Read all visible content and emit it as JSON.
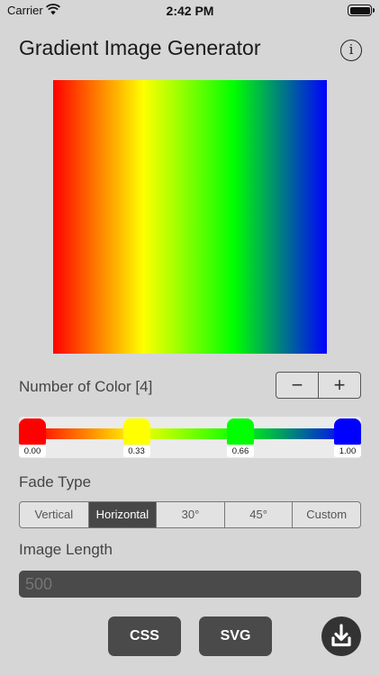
{
  "status": {
    "carrier": "Carrier",
    "time": "2:42 PM"
  },
  "header": {
    "title": "Gradient Image Generator",
    "info_glyph": "i"
  },
  "colors": {
    "count_label": "Number of Color [4]",
    "minus": "−",
    "plus": "+"
  },
  "stops": [
    {
      "color": "#ff0000",
      "value": "0.00"
    },
    {
      "color": "#ffff00",
      "value": "0.33"
    },
    {
      "color": "#00ff00",
      "value": "0.66"
    },
    {
      "color": "#0000ff",
      "value": "1.00"
    }
  ],
  "fade": {
    "label": "Fade Type",
    "options": [
      "Vertical",
      "Horizontal",
      "30°",
      "45°",
      "Custom"
    ],
    "selected": "Horizontal"
  },
  "length": {
    "label": "Image Length",
    "placeholder": "500"
  },
  "actions": {
    "css": "CSS",
    "svg": "SVG"
  },
  "icons": [
    "wifi-icon",
    "battery-icon",
    "info-icon",
    "download-icon"
  ]
}
